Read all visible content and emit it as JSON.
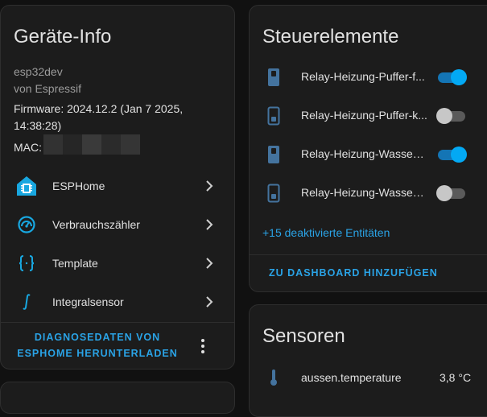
{
  "device_info": {
    "title": "Geräte-Info",
    "model": "esp32dev",
    "manufacturer": "von Espressif",
    "firmware_line1": "Firmware: 2024.12.2 (Jan 7 2025,",
    "firmware_line2": "14:38:28)",
    "mac_label": "MAC:",
    "integrations": [
      {
        "label": "ESPHome",
        "icon": "esphome-icon"
      },
      {
        "label": "Verbrauchszähler",
        "icon": "gauge-icon"
      },
      {
        "label": "Template",
        "icon": "curly-braces-icon"
      },
      {
        "label": "Integralsensor",
        "icon": "integral-icon"
      }
    ],
    "download_line1": "DIAGNOSEDATEN VON",
    "download_line2": "ESPHOME HERUNTERLADEN"
  },
  "controls": {
    "title": "Steuerelemente",
    "items": [
      {
        "label": "Relay-Heizung-Puffer-f...",
        "state": "on"
      },
      {
        "label": "Relay-Heizung-Puffer-k...",
        "state": "off"
      },
      {
        "label": "Relay-Heizung-Wasser-...",
        "state": "on"
      },
      {
        "label": "Relay-Heizung-Wasser-...",
        "state": "off"
      }
    ],
    "disabled_link": "+15 deaktivierte Entitäten",
    "add_to_dashboard": "ZU DASHBOARD HINZUFÜGEN"
  },
  "sensors": {
    "title": "Sensoren",
    "items": [
      {
        "label": "aussen.temperature",
        "value": "3,8 °C",
        "icon": "thermometer-icon"
      }
    ]
  },
  "colors": {
    "accent": "#03a9f4",
    "link": "#2aa3e6",
    "card_bg": "#1c1c1c",
    "page_bg": "#111111",
    "icon_blue": "#44739e"
  }
}
